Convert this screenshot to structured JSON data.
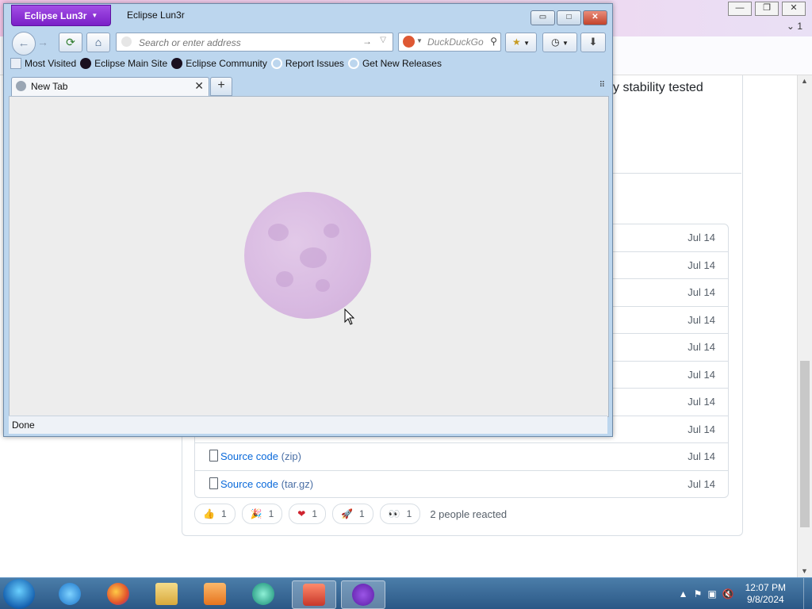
{
  "background_browser": {
    "tab_count": "1",
    "release_text": "tly stability tested",
    "assets": [
      {
        "name": "",
        "ext": "",
        "date": "Jul 14"
      },
      {
        "name": "",
        "ext": "",
        "date": "Jul 14"
      },
      {
        "name": "",
        "ext": "",
        "date": "Jul 14"
      },
      {
        "name": "",
        "ext": "",
        "date": "Jul 14"
      },
      {
        "name": "",
        "ext": "",
        "date": "Jul 14"
      },
      {
        "name": "",
        "ext": "",
        "date": "Jul 14"
      },
      {
        "name": "",
        "ext": "",
        "date": "Jul 14"
      },
      {
        "name": "",
        "ext": "",
        "date": "Jul 14"
      },
      {
        "name": "Source code",
        "ext": "(zip)",
        "date": "Jul 14"
      },
      {
        "name": "Source code",
        "ext": "(tar.gz)",
        "date": "Jul 14"
      }
    ],
    "reactions": [
      {
        "emoji": "👍",
        "count": "1"
      },
      {
        "emoji": "🎉",
        "count": "1"
      },
      {
        "emoji": "❤",
        "count": "1"
      },
      {
        "emoji": "🚀",
        "count": "1"
      },
      {
        "emoji": "👀",
        "count": "1"
      }
    ],
    "reacted_text": "2 people reacted"
  },
  "window": {
    "app_button": "Eclipse Lun3r",
    "title": "Eclipse Lun3r",
    "controls": {
      "minimize": "▭",
      "maximize": "□",
      "close": "✕"
    }
  },
  "navbar": {
    "url_placeholder": "Search or enter address",
    "search_placeholder": "DuckDuckGo"
  },
  "bookmarks": [
    {
      "label": "Most Visited",
      "icon": "most-visited-icon"
    },
    {
      "label": "Eclipse Main Site",
      "icon": "eclipse-icon"
    },
    {
      "label": "Eclipse Community",
      "icon": "eclipse-icon"
    },
    {
      "label": "Report Issues",
      "icon": "github-icon"
    },
    {
      "label": "Get New Releases",
      "icon": "github-icon"
    }
  ],
  "tabs": [
    {
      "label": "New Tab"
    }
  ],
  "status": "Done",
  "taskbar": {
    "time": "12:07 PM",
    "date": "9/8/2024"
  }
}
